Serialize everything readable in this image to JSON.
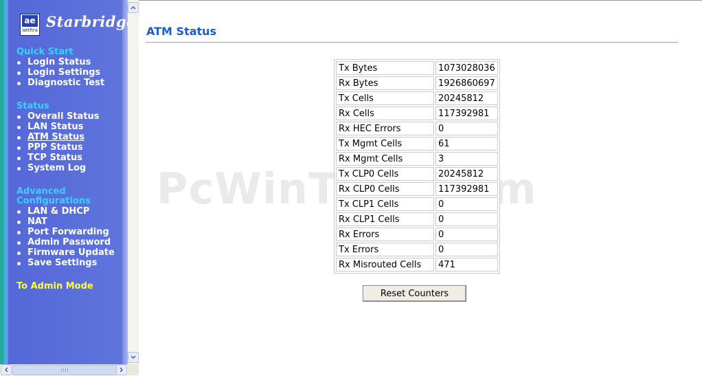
{
  "brand": {
    "name": "Starbridge",
    "logo_mark": "ae",
    "logo_sub": "aethra"
  },
  "nav": {
    "quick_start": {
      "heading": "Quick Start",
      "items": [
        "Login Status",
        "Login Settings",
        "Diagnostic Test"
      ]
    },
    "status": {
      "heading": "Status",
      "items": [
        "Overall Status",
        "LAN Status",
        "ATM Status",
        "PPP Status",
        "TCP Status",
        "System Log"
      ]
    },
    "advanced": {
      "heading_line1": "Advanced",
      "heading_line2": "Configurations",
      "items": [
        "LAN & DHCP",
        "NAT",
        "Port Forwarding",
        "Admin Password",
        "Firmware Update",
        "Save Settings"
      ]
    },
    "admin_mode": "To Admin Mode"
  },
  "page": {
    "title": "ATM Status"
  },
  "watermark": "PcWinTech.com",
  "stats": [
    {
      "label": "Tx Bytes",
      "value": "1073028036"
    },
    {
      "label": "Rx Bytes",
      "value": "1926860697"
    },
    {
      "label": "Tx Cells",
      "value": "20245812"
    },
    {
      "label": "Rx Cells",
      "value": "117392981"
    },
    {
      "label": "Rx HEC Errors",
      "value": "0"
    },
    {
      "label": "Tx Mgmt Cells",
      "value": "61"
    },
    {
      "label": "Rx Mgmt Cells",
      "value": "3"
    },
    {
      "label": "Tx CLP0 Cells",
      "value": "20245812"
    },
    {
      "label": "Rx CLP0 Cells",
      "value": "117392981"
    },
    {
      "label": "Tx CLP1 Cells",
      "value": "0"
    },
    {
      "label": "Rx CLP1 Cells",
      "value": "0"
    },
    {
      "label": "Rx Errors",
      "value": "0"
    },
    {
      "label": "Tx Errors",
      "value": "0"
    },
    {
      "label": "Rx Misrouted Cells",
      "value": "471"
    }
  ],
  "buttons": {
    "reset": "Reset Counters"
  },
  "colors": {
    "nav_bg": "#5a6fd8",
    "nav_heading": "#33d2ff",
    "admin_link": "#ffff33",
    "title": "#1a5fc8"
  }
}
